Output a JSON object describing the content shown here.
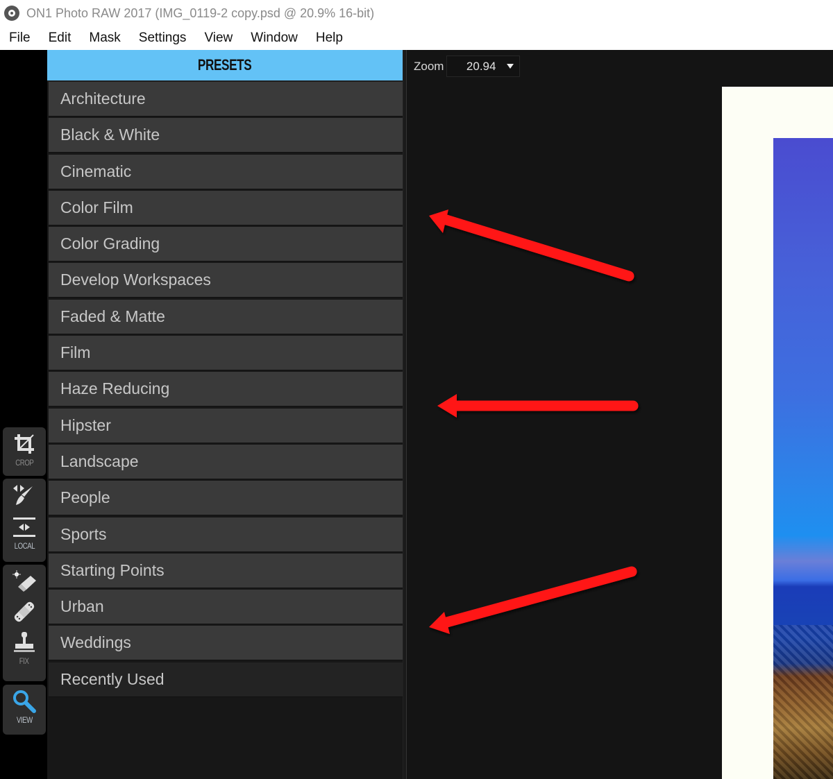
{
  "window": {
    "title": "ON1 Photo RAW 2017 (IMG_0119-2 copy.psd @ 20.9% 16-bit)",
    "app_icon": "aperture-icon"
  },
  "menu": {
    "items": [
      "File",
      "Edit",
      "Mask",
      "Settings",
      "View",
      "Window",
      "Help"
    ]
  },
  "toolstrip": {
    "groups": [
      {
        "label": "CROP",
        "tools": [
          "crop-icon"
        ]
      },
      {
        "label": "LOCAL",
        "tools": [
          "brush-icon",
          "gradient-icon"
        ]
      },
      {
        "label": "FIX",
        "tools": [
          "eraser-icon",
          "bandage-icon",
          "stamp-icon"
        ]
      },
      {
        "label": "VIEW",
        "tools": [
          "magnifier-icon"
        ]
      }
    ]
  },
  "presets": {
    "header": "PRESETS",
    "items": [
      "Architecture",
      "Black & White",
      "Cinematic",
      "Color Film",
      "Color Grading",
      "Develop Workspaces",
      "Faded & Matte",
      "Film",
      "Haze Reducing",
      "Hipster",
      "Landscape",
      "People",
      "Sports",
      "Starting Points",
      "Urban",
      "Weddings",
      "Recently Used"
    ]
  },
  "canvas": {
    "zoom_label": "Zoom",
    "zoom_value": "20.94"
  },
  "colors": {
    "accent": "#63c2f6",
    "annotation_arrow": "#ff1a1a"
  }
}
